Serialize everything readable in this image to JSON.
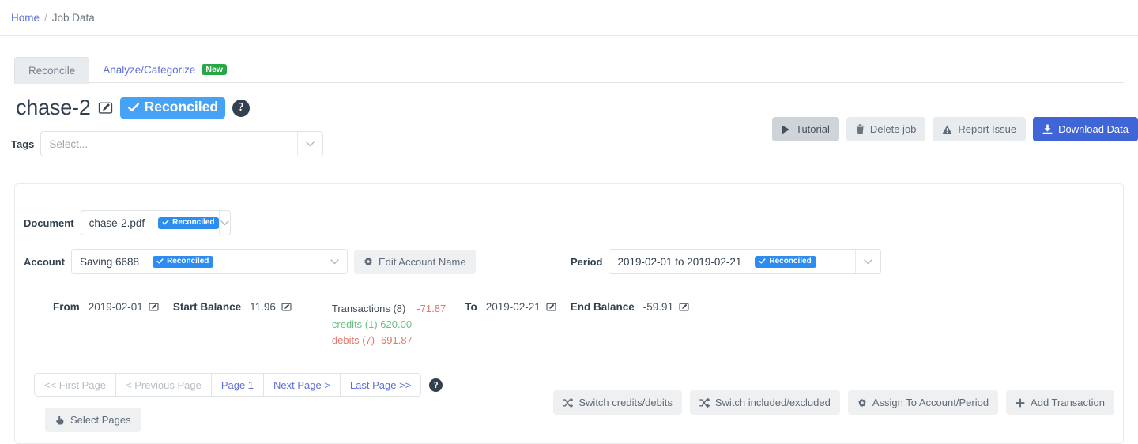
{
  "breadcrumb": {
    "home": "Home",
    "separator": "/",
    "current": "Job Data"
  },
  "tabs": [
    {
      "label": "Reconcile",
      "active": true,
      "badge": ""
    },
    {
      "label": "Analyze/Categorize",
      "active": false,
      "badge": "New"
    }
  ],
  "header": {
    "job_title": "chase-2",
    "status_badge": "Reconciled",
    "edit_icon": "edit-pencil-icon",
    "help_icon": "question-mark-icon"
  },
  "toolbar": {
    "tutorial": "Tutorial",
    "delete_job": "Delete job",
    "report_issue": "Report Issue",
    "download_data": "Download Data"
  },
  "tags": {
    "label": "Tags",
    "placeholder": "Select...",
    "value": ""
  },
  "document": {
    "label": "Document",
    "value": "chase-2.pdf",
    "status": "Reconciled"
  },
  "account": {
    "label": "Account",
    "value": "Saving 6688",
    "status": "Reconciled",
    "edit_button": "Edit Account Name"
  },
  "period": {
    "label": "Period",
    "value": "2019-02-01 to 2019-02-21",
    "status": "Reconciled"
  },
  "summary": {
    "from_label": "From",
    "from_value": "2019-02-01",
    "start_balance_label": "Start Balance",
    "start_balance_value": "11.96",
    "transactions_label": "Transactions (8)",
    "transactions_net": "-71.87",
    "credits_line": "credits (1) 620.00",
    "debits_line": "debits (7) -691.87",
    "to_label": "To",
    "to_value": "2019-02-21",
    "end_balance_label": "End Balance",
    "end_balance_value": "-59.91"
  },
  "pager": {
    "first": "<< First Page",
    "previous": "< Previous Page",
    "current": "Page 1",
    "next": "Next Page >",
    "last": "Last Page >>",
    "select_pages": "Select Pages"
  },
  "actions": {
    "switch_credits_debits": "Switch credits/debits",
    "switch_included_excluded": "Switch included/excluded",
    "assign_to_account_period": "Assign To Account/Period",
    "add_transaction": "Add Transaction"
  },
  "colors": {
    "link": "#6070d8",
    "primary": "#4065d6",
    "badge_blue": "#2d8cf0",
    "badge_blue_large": "#46a2f5",
    "badge_green": "#28a745",
    "credit_green": "#67c282",
    "debit_red": "#e8776b"
  }
}
